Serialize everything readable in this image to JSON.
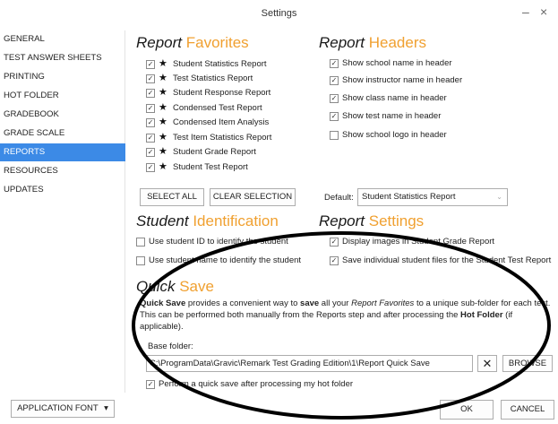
{
  "window": {
    "title": "Settings",
    "minimize": "–",
    "close": "×"
  },
  "sidebar": {
    "items": [
      {
        "label": "GENERAL"
      },
      {
        "label": "TEST ANSWER SHEETS"
      },
      {
        "label": "PRINTING"
      },
      {
        "label": "HOT FOLDER"
      },
      {
        "label": "GRADEBOOK"
      },
      {
        "label": "GRADE SCALE"
      },
      {
        "label": "REPORTS",
        "active": true
      },
      {
        "label": "RESOURCES"
      },
      {
        "label": "UPDATES"
      }
    ],
    "app_font_label": "APPLICATION FONT"
  },
  "report_favorites": {
    "title_a": "Report ",
    "title_b": "Favorites",
    "items": [
      {
        "label": "Student Statistics Report",
        "checked": true
      },
      {
        "label": "Test Statistics Report",
        "checked": true
      },
      {
        "label": "Student Response Report",
        "checked": true
      },
      {
        "label": "Condensed Test Report",
        "checked": true
      },
      {
        "label": "Condensed Item Analysis",
        "checked": true
      },
      {
        "label": "Test Item Statistics Report",
        "checked": true
      },
      {
        "label": "Student Grade Report",
        "checked": true
      },
      {
        "label": "Student Test Report",
        "checked": true
      }
    ],
    "select_all": "SELECT ALL",
    "clear_selection": "CLEAR SELECTION",
    "default_label": "Default:",
    "default_value": "Student Statistics Report"
  },
  "report_headers": {
    "title_a": "Report ",
    "title_b": "Headers",
    "items": [
      {
        "label": "Show school name in header",
        "checked": true
      },
      {
        "label": "Show instructor name in header",
        "checked": true
      },
      {
        "label": "Show class name in header",
        "checked": true
      },
      {
        "label": "Show test name in header",
        "checked": true
      },
      {
        "label": "Show school logo in header",
        "checked": false
      }
    ]
  },
  "student_identification": {
    "title_a": "Student ",
    "title_b": "Identification",
    "items": [
      {
        "label": "Use student ID to identify the student",
        "checked": false
      },
      {
        "label": "Use student name to identify the student",
        "checked": false
      }
    ]
  },
  "report_settings": {
    "title_a": "Report ",
    "title_b": "Settings",
    "items": [
      {
        "label": "Display images in Student Grade Report",
        "checked": true
      },
      {
        "label": "Save individual student files for the Student Test Report",
        "checked": true
      }
    ]
  },
  "quick_save": {
    "title_a": "Quick ",
    "title_b": "Save",
    "para_1": "Quick Save",
    "para_2": " provides a convenient way to ",
    "para_3": "save",
    "para_4": " all your ",
    "para_5": "Report Favorites",
    "para_6": " to a unique sub-folder for each test. This can be performed both manually from the Reports step and after processing the ",
    "para_7": "Hot Folder",
    "para_8": " (if applicable).",
    "base_folder_label": "Base folder:",
    "base_folder_value": "C:\\ProgramData\\Gravic\\Remark Test Grading Edition\\1\\Report Quick Save",
    "clear_glyph": "✕",
    "browse": "BROWSE",
    "auto_save_label": "Perform a quick save after processing my hot folder",
    "auto_save_checked": true
  },
  "footer": {
    "ok": "OK",
    "cancel": "CANCEL"
  },
  "check_glyph": "✓",
  "star_glyph": "★",
  "caret_glyph": "⌄",
  "colors": {
    "accent": "#f0a030",
    "selected": "#3c8ae6"
  }
}
